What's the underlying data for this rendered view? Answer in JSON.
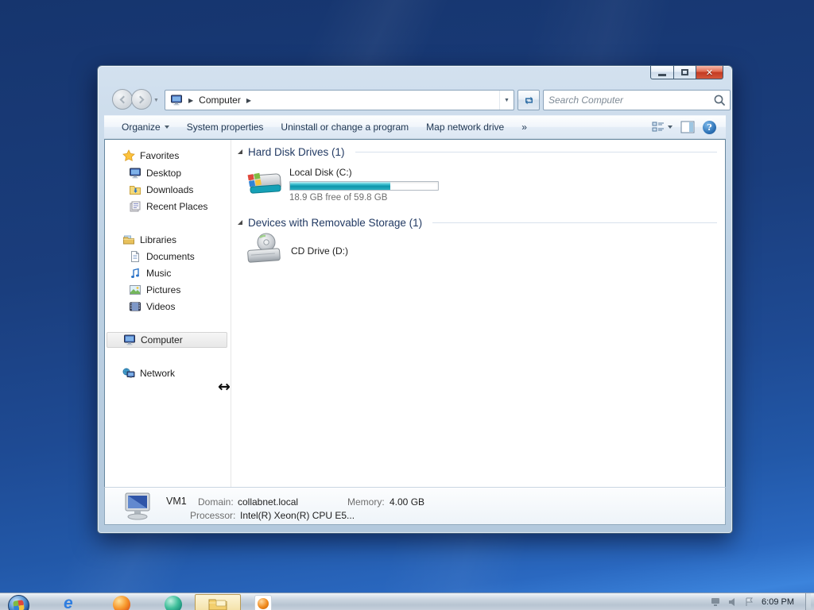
{
  "window": {
    "controls": {
      "close_glyph": "✕"
    }
  },
  "navigation": {
    "breadcrumb": {
      "separator": "▶",
      "location": "Computer"
    },
    "address_dropdown_glyph": "▼",
    "history_dropdown_glyph": "▼"
  },
  "search": {
    "placeholder": "Search Computer"
  },
  "toolbar": {
    "items": [
      {
        "label": "Organize"
      },
      {
        "label": "System properties"
      },
      {
        "label": "Uninstall or change a program"
      },
      {
        "label": "Map network drive"
      },
      {
        "label": "»"
      }
    ]
  },
  "sidebar": {
    "groups": [
      {
        "label": "Favorites",
        "children": [
          {
            "label": "Desktop"
          },
          {
            "label": "Downloads"
          },
          {
            "label": "Recent Places"
          }
        ]
      },
      {
        "label": "Libraries",
        "children": [
          {
            "label": "Documents"
          },
          {
            "label": "Music"
          },
          {
            "label": "Pictures"
          },
          {
            "label": "Videos"
          }
        ]
      },
      {
        "label": "Computer",
        "selected": true,
        "children": []
      },
      {
        "label": "Network",
        "children": []
      }
    ]
  },
  "main": {
    "groups": [
      {
        "label": "Hard Disk Drives (1)"
      },
      {
        "label": "Devices with Removable Storage (1)"
      }
    ],
    "hard_disk": {
      "name": "Local Disk (C:)",
      "free_text": "18.9 GB free of 59.8 GB",
      "used_percent": 68,
      "fill_style": "width:68%"
    },
    "cd_drive": {
      "name": "CD Drive (D:)"
    }
  },
  "details": {
    "computer_name": "VM1",
    "domain_label": "Domain:",
    "domain_value": "collabnet.local",
    "memory_label": "Memory:",
    "memory_value": "4.00 GB",
    "processor_label": "Processor:",
    "processor_value": "Intel(R) Xeon(R) CPU E5..."
  },
  "taskbar": {
    "clock": "6:09 PM"
  }
}
